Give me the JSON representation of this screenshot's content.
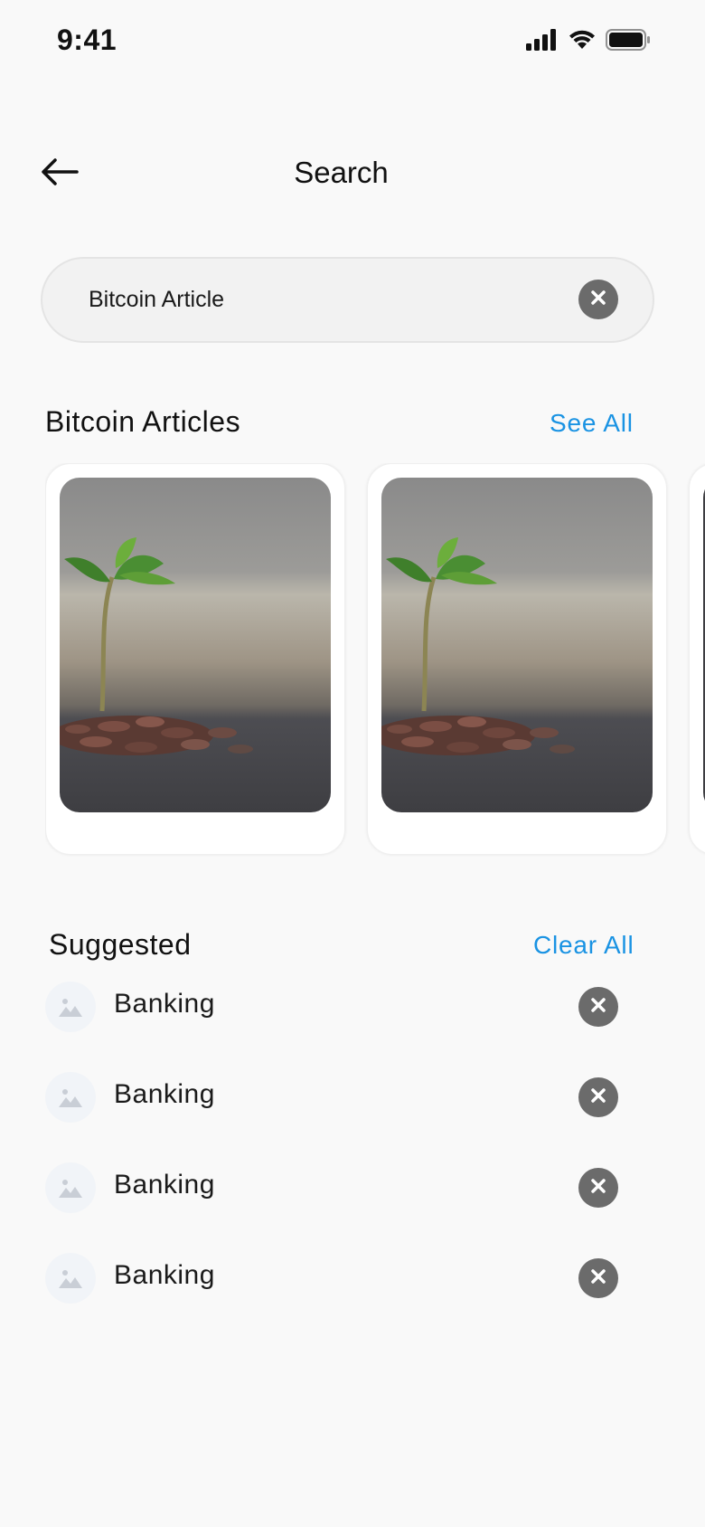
{
  "status_bar": {
    "time": "9:41",
    "signal_icon": "cellular-signal-icon",
    "wifi_icon": "wifi-icon",
    "battery_icon": "battery-icon"
  },
  "header": {
    "title": "Search",
    "back_icon": "back-arrow-icon"
  },
  "search": {
    "value": "Bitcoin Article",
    "clear_icon": "close-icon"
  },
  "articles_section": {
    "title": "Bitcoin Articles",
    "link": "See All",
    "cards": [
      {
        "image": "plant-growing-from-coins"
      },
      {
        "image": "plant-growing-from-coins"
      },
      {
        "image": "plant-growing-from-coins"
      }
    ]
  },
  "suggested_section": {
    "title": "Suggested",
    "link": "Clear All",
    "items": [
      {
        "label": "Banking",
        "icon": "image-placeholder-icon"
      },
      {
        "label": "Banking",
        "icon": "image-placeholder-icon"
      },
      {
        "label": "Banking",
        "icon": "image-placeholder-icon"
      },
      {
        "label": "Banking",
        "icon": "image-placeholder-icon"
      }
    ]
  },
  "colors": {
    "accent": "#1a93e3",
    "background": "#f9f9f9",
    "close_button": "#6b6b6b"
  }
}
